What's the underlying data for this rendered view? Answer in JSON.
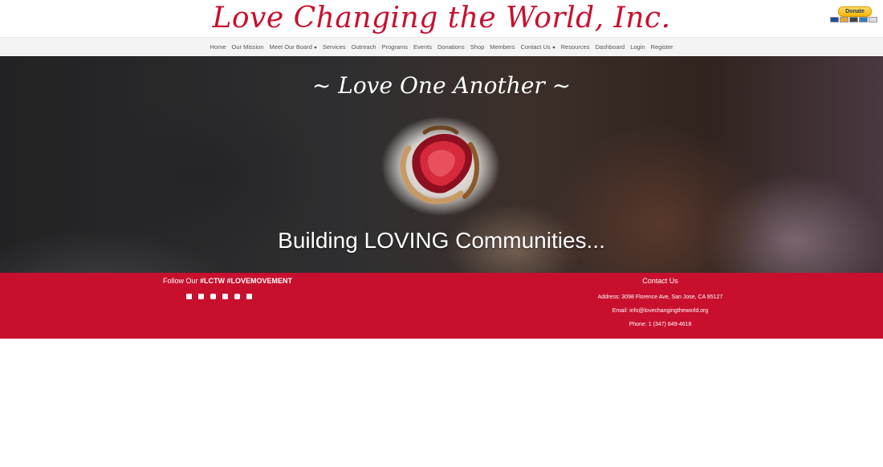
{
  "header": {
    "brand_title": "Love Changing the World, Inc.",
    "donate_label": "Donate",
    "payment_cards": [
      "visa-card-icon",
      "mastercard-icon",
      "discover-card-icon",
      "amex-card-icon",
      "bank-card-icon"
    ]
  },
  "nav": {
    "items": [
      {
        "label": "Home",
        "dropdown": false
      },
      {
        "label": "Our Mission",
        "dropdown": false
      },
      {
        "label": "Meet Our Board",
        "dropdown": true
      },
      {
        "label": "Services",
        "dropdown": false
      },
      {
        "label": "Outreach",
        "dropdown": false
      },
      {
        "label": "Programs",
        "dropdown": false
      },
      {
        "label": "Events",
        "dropdown": false
      },
      {
        "label": "Donations",
        "dropdown": false
      },
      {
        "label": "Shop",
        "dropdown": false
      },
      {
        "label": "Members",
        "dropdown": false
      },
      {
        "label": "Contact Us",
        "dropdown": true
      },
      {
        "label": "Resources",
        "dropdown": false
      },
      {
        "label": "Dashboard",
        "dropdown": false
      },
      {
        "label": "Login",
        "dropdown": false
      },
      {
        "label": "Register",
        "dropdown": false
      }
    ]
  },
  "hero": {
    "tagline": "~ Love One Another ~",
    "title": "Building LOVING Communities..."
  },
  "footer": {
    "follow_prefix": "Follow Our ",
    "follow_tags": "#LCTW #LOVEMOVEMENT",
    "social_icons": [
      "facebook-icon",
      "twitter-icon",
      "instagram-icon",
      "linkedin-icon",
      "youtube-icon",
      "user-icon"
    ],
    "contact_heading": "Contact Us",
    "address": "Address: 3098 Florence Ave, San Jose, CA 95127",
    "email": "Email: info@lovechangingtheworld.org",
    "phone": "Phone: 1 (347) 849-4618"
  },
  "colors": {
    "brand_red": "#c8102e",
    "nav_bg": "#f4f4f4",
    "donate_gold": "#f7b500"
  }
}
